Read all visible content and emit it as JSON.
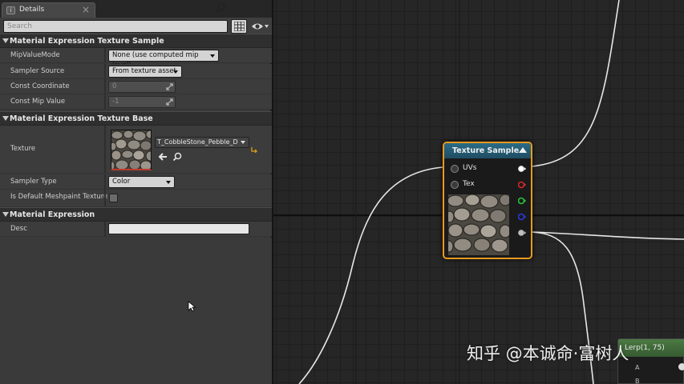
{
  "tab": {
    "title": "Details",
    "icon": "details-panel-icon"
  },
  "search": {
    "placeholder": "Search"
  },
  "toolbar": {
    "icons": [
      "search-icon",
      "grid-view-icon",
      "eye-visibility-icon"
    ]
  },
  "sections": {
    "texture_sample": {
      "title": "Material Expression Texture Sample",
      "rows": {
        "mip_value_mode": {
          "label": "MipValueMode",
          "value": "None (use computed mip level)"
        },
        "sampler_source": {
          "label": "Sampler Source",
          "value": "From texture asset"
        },
        "const_coordinate": {
          "label": "Const Coordinate",
          "value": "0"
        },
        "const_mip_value": {
          "label": "Const Mip Value",
          "value": "-1"
        }
      }
    },
    "texture_base": {
      "title": "Material Expression Texture Base",
      "rows": {
        "texture": {
          "label": "Texture",
          "value": "T_CobbleStone_Pebble_D"
        },
        "sampler_type": {
          "label": "Sampler Type",
          "value": "Color"
        },
        "is_default_meshpaint": {
          "label": "Is Default Meshpaint Texture",
          "checked": false
        }
      }
    },
    "expression": {
      "title": "Material Expression",
      "rows": {
        "desc": {
          "label": "Desc",
          "value": ""
        }
      }
    }
  },
  "graph": {
    "node": {
      "title": "Texture Sample",
      "inputs": [
        "UVs",
        "Tex"
      ],
      "output_pin_colors": [
        "#ffffff",
        "#d22a2a",
        "#28c23a",
        "#2a3ad8",
        "#bdbdbd"
      ]
    },
    "node2": {
      "title": "Lerp(1, 75)",
      "inputs": [
        "A",
        "B"
      ]
    }
  },
  "watermark": "知乎 @本诚命·富树人",
  "colors": {
    "node_border": "#e79a1e",
    "node_header": "#2b6b86",
    "panel_bg": "#3a3a3a",
    "graph_bg": "#262626"
  }
}
